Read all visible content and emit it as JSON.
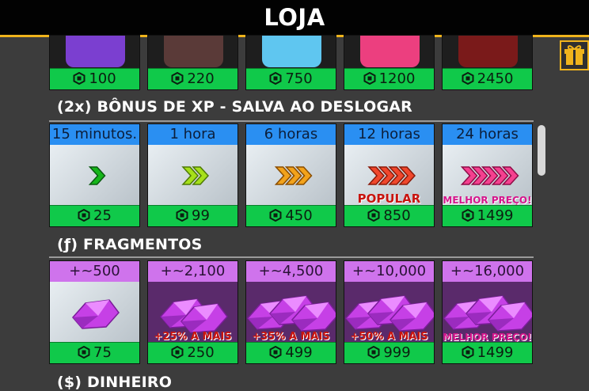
{
  "header": {
    "title": "LOJA"
  },
  "colors": {
    "accent": "#f0b41c",
    "price_green": "#10c94a",
    "xp_blue": "#2a8ff2",
    "frag_purple": "#cf73ec"
  },
  "top_row": [
    {
      "price": "100"
    },
    {
      "price": "220"
    },
    {
      "price": "750"
    },
    {
      "price": "1200"
    },
    {
      "price": "2450"
    }
  ],
  "xp_section": {
    "title": "(2x) BÔNUS DE XP - SALVA AO DESLOGAR",
    "items": [
      {
        "duration": "15 minutos.",
        "price": "25",
        "tag": ""
      },
      {
        "duration": "1 hora",
        "price": "99",
        "tag": ""
      },
      {
        "duration": "6 horas",
        "price": "450",
        "tag": ""
      },
      {
        "duration": "12 horas",
        "price": "850",
        "tag": "POPULAR"
      },
      {
        "duration": "24 horas",
        "price": "1499",
        "tag": "MELHOR PREÇO!"
      }
    ]
  },
  "fragments_section": {
    "title": "(ƒ) FRAGMENTOS",
    "items": [
      {
        "amount": "+~500",
        "price": "75",
        "tag": ""
      },
      {
        "amount": "+~2,100",
        "price": "250",
        "tag": "+25% A MAIS"
      },
      {
        "amount": "+~4,500",
        "price": "499",
        "tag": "+35% A MAIS"
      },
      {
        "amount": "+~10,000",
        "price": "999",
        "tag": "+50% A MAIS"
      },
      {
        "amount": "+~16,000",
        "price": "1499",
        "tag": "MELHOR PREÇO!"
      }
    ]
  },
  "money_section": {
    "title": "($) DINHEIRO"
  },
  "icons": {
    "currency": "robux-icon",
    "gift": "gift-icon"
  }
}
